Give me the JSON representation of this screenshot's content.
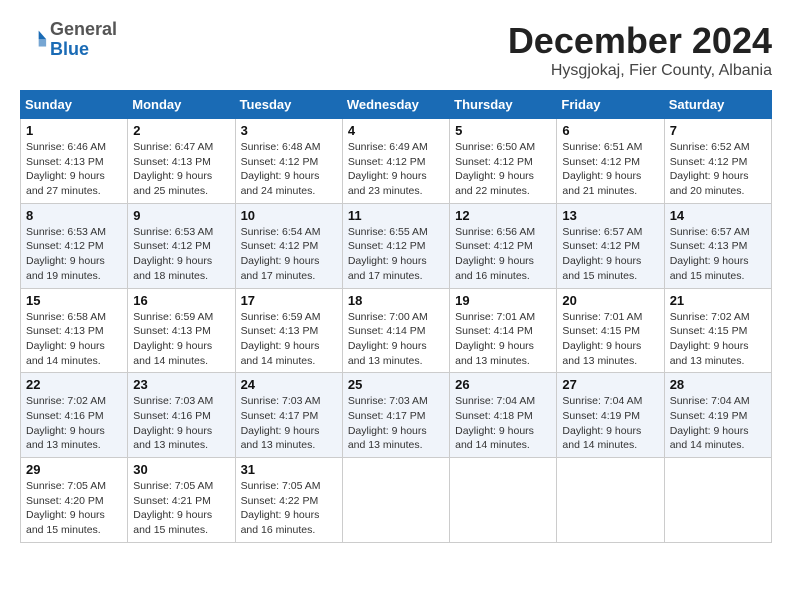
{
  "header": {
    "logo_general": "General",
    "logo_blue": "Blue",
    "month_title": "December 2024",
    "location": "Hysgjokaj, Fier County, Albania"
  },
  "weekdays": [
    "Sunday",
    "Monday",
    "Tuesday",
    "Wednesday",
    "Thursday",
    "Friday",
    "Saturday"
  ],
  "weeks": [
    [
      {
        "day": "1",
        "sunrise": "6:46 AM",
        "sunset": "4:13 PM",
        "daylight": "9 hours and 27 minutes."
      },
      {
        "day": "2",
        "sunrise": "6:47 AM",
        "sunset": "4:13 PM",
        "daylight": "9 hours and 25 minutes."
      },
      {
        "day": "3",
        "sunrise": "6:48 AM",
        "sunset": "4:12 PM",
        "daylight": "9 hours and 24 minutes."
      },
      {
        "day": "4",
        "sunrise": "6:49 AM",
        "sunset": "4:12 PM",
        "daylight": "9 hours and 23 minutes."
      },
      {
        "day": "5",
        "sunrise": "6:50 AM",
        "sunset": "4:12 PM",
        "daylight": "9 hours and 22 minutes."
      },
      {
        "day": "6",
        "sunrise": "6:51 AM",
        "sunset": "4:12 PM",
        "daylight": "9 hours and 21 minutes."
      },
      {
        "day": "7",
        "sunrise": "6:52 AM",
        "sunset": "4:12 PM",
        "daylight": "9 hours and 20 minutes."
      }
    ],
    [
      {
        "day": "8",
        "sunrise": "6:53 AM",
        "sunset": "4:12 PM",
        "daylight": "9 hours and 19 minutes."
      },
      {
        "day": "9",
        "sunrise": "6:53 AM",
        "sunset": "4:12 PM",
        "daylight": "9 hours and 18 minutes."
      },
      {
        "day": "10",
        "sunrise": "6:54 AM",
        "sunset": "4:12 PM",
        "daylight": "9 hours and 17 minutes."
      },
      {
        "day": "11",
        "sunrise": "6:55 AM",
        "sunset": "4:12 PM",
        "daylight": "9 hours and 17 minutes."
      },
      {
        "day": "12",
        "sunrise": "6:56 AM",
        "sunset": "4:12 PM",
        "daylight": "9 hours and 16 minutes."
      },
      {
        "day": "13",
        "sunrise": "6:57 AM",
        "sunset": "4:12 PM",
        "daylight": "9 hours and 15 minutes."
      },
      {
        "day": "14",
        "sunrise": "6:57 AM",
        "sunset": "4:13 PM",
        "daylight": "9 hours and 15 minutes."
      }
    ],
    [
      {
        "day": "15",
        "sunrise": "6:58 AM",
        "sunset": "4:13 PM",
        "daylight": "9 hours and 14 minutes."
      },
      {
        "day": "16",
        "sunrise": "6:59 AM",
        "sunset": "4:13 PM",
        "daylight": "9 hours and 14 minutes."
      },
      {
        "day": "17",
        "sunrise": "6:59 AM",
        "sunset": "4:13 PM",
        "daylight": "9 hours and 14 minutes."
      },
      {
        "day": "18",
        "sunrise": "7:00 AM",
        "sunset": "4:14 PM",
        "daylight": "9 hours and 13 minutes."
      },
      {
        "day": "19",
        "sunrise": "7:01 AM",
        "sunset": "4:14 PM",
        "daylight": "9 hours and 13 minutes."
      },
      {
        "day": "20",
        "sunrise": "7:01 AM",
        "sunset": "4:15 PM",
        "daylight": "9 hours and 13 minutes."
      },
      {
        "day": "21",
        "sunrise": "7:02 AM",
        "sunset": "4:15 PM",
        "daylight": "9 hours and 13 minutes."
      }
    ],
    [
      {
        "day": "22",
        "sunrise": "7:02 AM",
        "sunset": "4:16 PM",
        "daylight": "9 hours and 13 minutes."
      },
      {
        "day": "23",
        "sunrise": "7:03 AM",
        "sunset": "4:16 PM",
        "daylight": "9 hours and 13 minutes."
      },
      {
        "day": "24",
        "sunrise": "7:03 AM",
        "sunset": "4:17 PM",
        "daylight": "9 hours and 13 minutes."
      },
      {
        "day": "25",
        "sunrise": "7:03 AM",
        "sunset": "4:17 PM",
        "daylight": "9 hours and 13 minutes."
      },
      {
        "day": "26",
        "sunrise": "7:04 AM",
        "sunset": "4:18 PM",
        "daylight": "9 hours and 14 minutes."
      },
      {
        "day": "27",
        "sunrise": "7:04 AM",
        "sunset": "4:19 PM",
        "daylight": "9 hours and 14 minutes."
      },
      {
        "day": "28",
        "sunrise": "7:04 AM",
        "sunset": "4:19 PM",
        "daylight": "9 hours and 14 minutes."
      }
    ],
    [
      {
        "day": "29",
        "sunrise": "7:05 AM",
        "sunset": "4:20 PM",
        "daylight": "9 hours and 15 minutes."
      },
      {
        "day": "30",
        "sunrise": "7:05 AM",
        "sunset": "4:21 PM",
        "daylight": "9 hours and 15 minutes."
      },
      {
        "day": "31",
        "sunrise": "7:05 AM",
        "sunset": "4:22 PM",
        "daylight": "9 hours and 16 minutes."
      },
      null,
      null,
      null,
      null
    ]
  ]
}
